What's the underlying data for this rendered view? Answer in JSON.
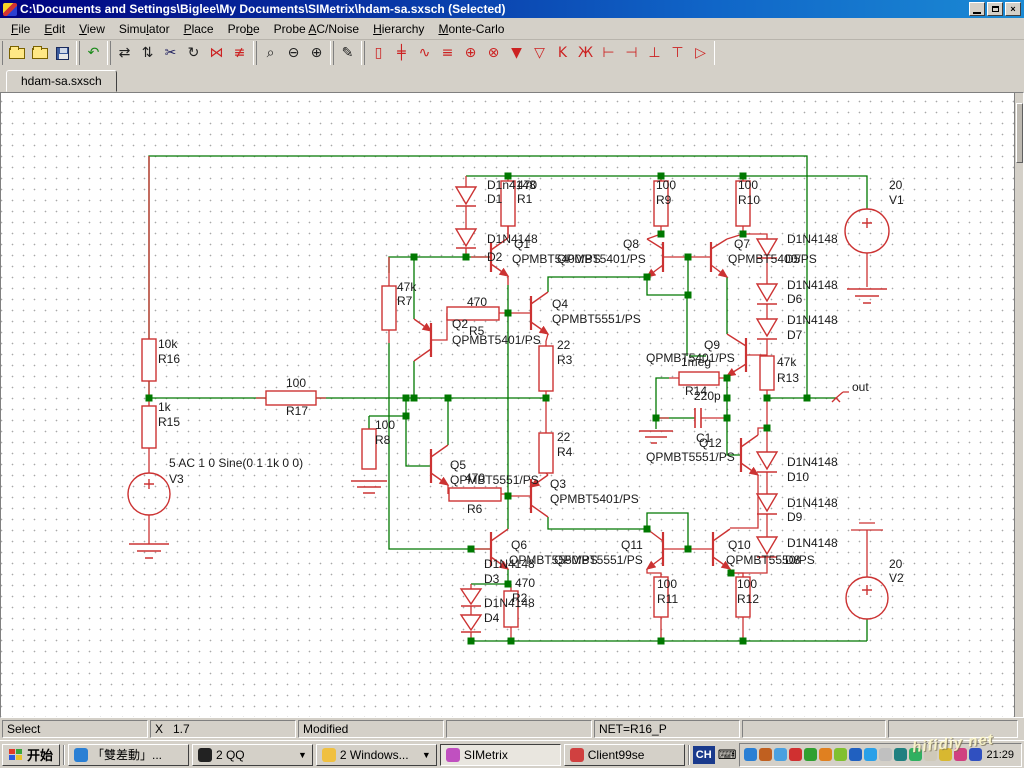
{
  "window": {
    "title": "C:\\Documents and Settings\\Biglee\\My Documents\\SIMetrix\\hdam-sa.sxsch (Selected)",
    "buttons": {
      "minimize": "minimize",
      "restore": "restore",
      "close": "close"
    }
  },
  "menu": {
    "items": [
      {
        "label": "File",
        "u": 0
      },
      {
        "label": "Edit",
        "u": 0
      },
      {
        "label": "View",
        "u": 0
      },
      {
        "label": "Simulator",
        "u": 4
      },
      {
        "label": "Place",
        "u": 0
      },
      {
        "label": "Probe",
        "u": 3
      },
      {
        "label": "Probe AC/Noise",
        "u": 6
      },
      {
        "label": "Hierarchy",
        "u": 0
      },
      {
        "label": "Monte-Carlo",
        "u": 0
      }
    ]
  },
  "toolbar": {
    "groups": [
      [
        {
          "name": "open-file",
          "cls": "i-folder"
        },
        {
          "name": "new-file",
          "cls": "i-folder"
        },
        {
          "name": "save-file",
          "cls": "i-floppy"
        }
      ],
      [
        {
          "name": "undo",
          "glyph": "↶",
          "color": "#1a8a1a"
        }
      ],
      [
        {
          "name": "flip-horizontal",
          "glyph": "⇄",
          "color": "#202020"
        },
        {
          "name": "flip-vertical",
          "glyph": "⇅",
          "color": "#202020"
        },
        {
          "name": "cut",
          "glyph": "✂",
          "color": "#202060"
        },
        {
          "name": "rotate",
          "glyph": "↻",
          "color": "#202020"
        },
        {
          "name": "mirror",
          "glyph": "⋈",
          "color": "#cc2222"
        },
        {
          "name": "unmirror",
          "glyph": "≢",
          "color": "#cc2222"
        }
      ],
      [
        {
          "name": "zoom-area",
          "glyph": "⌕",
          "color": "#202020"
        },
        {
          "name": "zoom-out",
          "glyph": "⊖",
          "color": "#202020"
        },
        {
          "name": "zoom-in",
          "glyph": "⊕",
          "color": "#202020"
        }
      ],
      [
        {
          "name": "wire-pen",
          "glyph": "✎",
          "color": "#202020"
        }
      ],
      [
        {
          "name": "place-resistor",
          "glyph": "▯",
          "color": "#cc2222"
        },
        {
          "name": "place-capacitor",
          "glyph": "╪",
          "color": "#cc2222"
        },
        {
          "name": "place-inductor",
          "glyph": "∿",
          "color": "#cc2222"
        },
        {
          "name": "place-ground",
          "glyph": "≡",
          "color": "#cc2222"
        },
        {
          "name": "place-voltage-source",
          "glyph": "⊕",
          "color": "#cc2222"
        },
        {
          "name": "place-current-source",
          "glyph": "⊗",
          "color": "#cc2222"
        },
        {
          "name": "place-diode",
          "glyph": "▼",
          "color": "#cc2222"
        },
        {
          "name": "place-zener",
          "glyph": "▽",
          "color": "#cc2222"
        },
        {
          "name": "place-npn",
          "glyph": "K",
          "color": "#cc2222"
        },
        {
          "name": "place-pnp",
          "glyph": "Ж",
          "color": "#cc2222"
        },
        {
          "name": "place-njfet",
          "glyph": "⊢",
          "color": "#cc2222"
        },
        {
          "name": "place-pjfet",
          "glyph": "⊣",
          "color": "#cc2222"
        },
        {
          "name": "place-nmos",
          "glyph": "⊥",
          "color": "#cc2222"
        },
        {
          "name": "place-pmos",
          "glyph": "⊤",
          "color": "#cc2222"
        },
        {
          "name": "place-buffer",
          "glyph": "▷",
          "color": "#cc2222"
        }
      ]
    ]
  },
  "tabs": {
    "active": "hdam-sa.sxsch"
  },
  "schematic": {
    "labels": [
      [
        486,
        188,
        "D1n4148"
      ],
      [
        516,
        188,
        "470"
      ],
      [
        486,
        202,
        "D1"
      ],
      [
        516,
        202,
        "R1"
      ],
      [
        486,
        242,
        "D1N4148"
      ],
      [
        486,
        260,
        "D2"
      ],
      [
        513,
        247,
        "Q1"
      ],
      [
        511,
        262,
        "QPMBT5400/PS"
      ],
      [
        622,
        247,
        "Q8"
      ],
      [
        556,
        262,
        "QPMBT5401/PS"
      ],
      [
        655,
        188,
        "100"
      ],
      [
        655,
        203,
        "R9"
      ],
      [
        737,
        188,
        "100"
      ],
      [
        737,
        203,
        "R10"
      ],
      [
        733,
        247,
        "Q7"
      ],
      [
        727,
        262,
        "QPMBT5400/PS"
      ],
      [
        786,
        242,
        "D1N4148"
      ],
      [
        784,
        262,
        "D5"
      ],
      [
        786,
        288,
        "D1N4148"
      ],
      [
        786,
        302,
        "D6"
      ],
      [
        786,
        323,
        "D1N4148"
      ],
      [
        786,
        338,
        "D7"
      ],
      [
        888,
        188,
        "20"
      ],
      [
        888,
        203,
        "V1"
      ],
      [
        396,
        290,
        "47k"
      ],
      [
        396,
        304,
        "R7"
      ],
      [
        466,
        305,
        "470"
      ],
      [
        451,
        327,
        "Q2"
      ],
      [
        468,
        334,
        "R5"
      ],
      [
        451,
        343,
        "QPMBT5401/PS"
      ],
      [
        551,
        307,
        "Q4"
      ],
      [
        551,
        322,
        "QPMBT5551/PS"
      ],
      [
        556,
        348,
        "22"
      ],
      [
        556,
        363,
        "R3"
      ],
      [
        157,
        347,
        "10k"
      ],
      [
        157,
        362,
        "R16"
      ],
      [
        157,
        410,
        "1k"
      ],
      [
        157,
        425,
        "R15"
      ],
      [
        285,
        386,
        "100"
      ],
      [
        285,
        414,
        "R17"
      ],
      [
        374,
        428,
        "100"
      ],
      [
        374,
        443,
        "R8"
      ],
      [
        556,
        440,
        "22"
      ],
      [
        556,
        455,
        "R4"
      ],
      [
        168,
        466,
        "5 AC 1 0 Sine(0 1 1k 0 0)"
      ],
      [
        168,
        482,
        "V3"
      ],
      [
        449,
        468,
        "Q5"
      ],
      [
        449,
        483,
        "QPMBT5551/PS"
      ],
      [
        464,
        481,
        "470"
      ],
      [
        466,
        512,
        "R6"
      ],
      [
        549,
        487,
        "Q3"
      ],
      [
        549,
        502,
        "QPMBT5401/PS"
      ],
      [
        510,
        548,
        "Q6"
      ],
      [
        508,
        563,
        "QPMBT5550/PS"
      ],
      [
        620,
        548,
        "Q11"
      ],
      [
        553,
        563,
        "QPMBT5551/PS"
      ],
      [
        483,
        567,
        "D1N4148"
      ],
      [
        483,
        582,
        "D3"
      ],
      [
        514,
        586,
        "470"
      ],
      [
        511,
        601,
        "R2"
      ],
      [
        483,
        606,
        "D1N4148"
      ],
      [
        483,
        621,
        "D4"
      ],
      [
        703,
        348,
        "Q9"
      ],
      [
        645,
        361,
        "QPMBT5401/PS"
      ],
      [
        680,
        365,
        "1meg"
      ],
      [
        684,
        394,
        "R14"
      ],
      [
        693,
        399,
        "220p"
      ],
      [
        695,
        441,
        "C1"
      ],
      [
        698,
        446,
        "Q12"
      ],
      [
        645,
        460,
        "QPMBT5551/PS"
      ],
      [
        776,
        365,
        "47k"
      ],
      [
        776,
        381,
        "R13"
      ],
      [
        851,
        390,
        "out"
      ],
      [
        786,
        465,
        "D1N4148"
      ],
      [
        786,
        480,
        "D10"
      ],
      [
        786,
        506,
        "D1N4148"
      ],
      [
        786,
        520,
        "D9"
      ],
      [
        786,
        546,
        "D1N4148"
      ],
      [
        784,
        563,
        "D8"
      ],
      [
        727,
        548,
        "Q10"
      ],
      [
        725,
        563,
        "QPMBT5550/PS"
      ],
      [
        656,
        587,
        "100"
      ],
      [
        656,
        602,
        "R11"
      ],
      [
        736,
        587,
        "100"
      ],
      [
        736,
        602,
        "R12"
      ],
      [
        888,
        567,
        "20"
      ],
      [
        888,
        581,
        "V2"
      ]
    ],
    "colors": {
      "wire": "#007800",
      "component": "#cc3333",
      "junction": "#007800",
      "label": "#1b1b1b"
    }
  },
  "statusbar": {
    "panels": [
      {
        "name": "status-mode",
        "w": 146,
        "text": "Select"
      },
      {
        "name": "status-cursor",
        "w": 146,
        "text": "X   1.7"
      },
      {
        "name": "status-modified",
        "w": 146,
        "text": "Modified"
      },
      {
        "name": "status-empty-1",
        "w": 146,
        "text": ""
      },
      {
        "name": "status-net",
        "w": 146,
        "text": "NET=R16_P"
      },
      {
        "name": "status-empty-2",
        "w": 144,
        "text": ""
      },
      {
        "name": "status-empty-3",
        "w": 130,
        "text": ""
      }
    ]
  },
  "taskbar": {
    "start_label": "开始",
    "buttons": [
      {
        "name": "task-browser",
        "label": "「雙差動」...",
        "icon": "#2a7fd4",
        "active": false,
        "dropdown": false
      },
      {
        "name": "task-qq",
        "label": "2 QQ",
        "icon": "#222222",
        "active": false,
        "dropdown": true
      },
      {
        "name": "task-windows",
        "label": "2 Windows...",
        "icon": "#f0c040",
        "active": false,
        "dropdown": true
      },
      {
        "name": "task-simetrix",
        "label": "SIMetrix",
        "icon": "#c050c0",
        "active": true,
        "dropdown": false
      },
      {
        "name": "task-client99se",
        "label": "Client99se",
        "icon": "#d04040",
        "active": false,
        "dropdown": false
      }
    ],
    "language_indicator": "CH",
    "keyboard_icon": "⌨",
    "tray_icons": [
      "#2a7fd4",
      "#c06020",
      "#4aa0e0",
      "#d03030",
      "#30a030",
      "#e08020",
      "#80c030",
      "#2060c0",
      "#2aa0e8",
      "#c0c0c0",
      "#208080",
      "#30b060",
      "#cfc9b8",
      "#d8b830",
      "#d04080",
      "#3050c0"
    ],
    "clock": "21:29",
    "watermark": "hifidiy net"
  }
}
